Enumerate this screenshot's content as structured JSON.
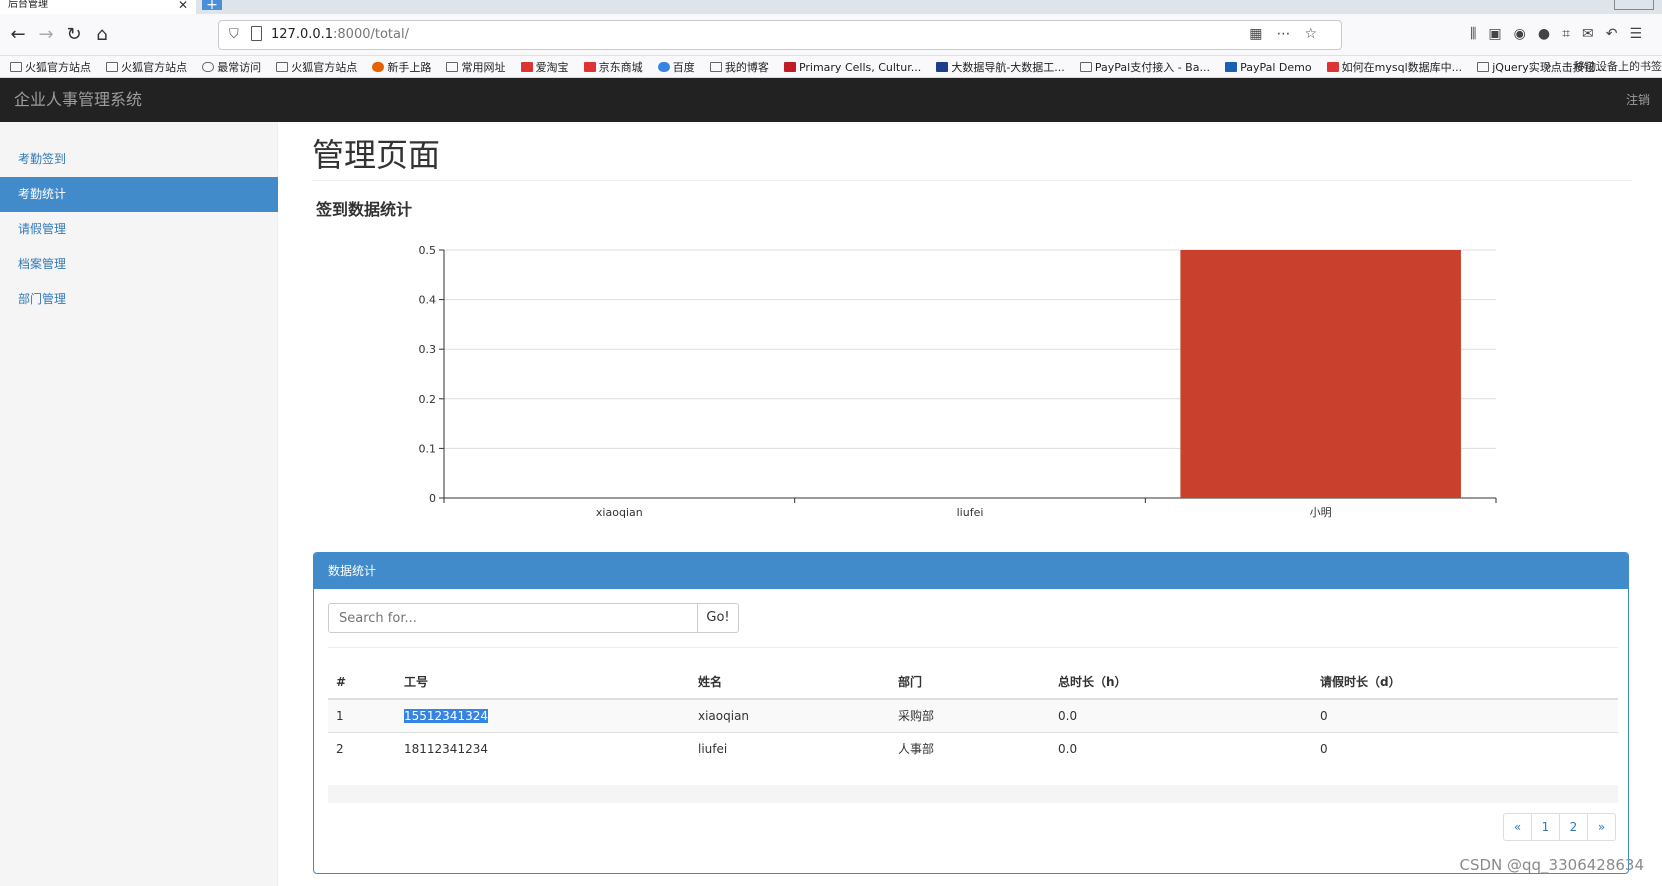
{
  "browser": {
    "tab_title": "后台管理",
    "tab_close": "✕",
    "new_tab": "+",
    "url_host": "127.0.0.1",
    "url_rest": ":8000/total/",
    "bookmarks": [
      "火狐官方站点",
      "火狐官方站点",
      "最常访问",
      "火狐官方站点",
      "新手上路",
      "常用网址",
      "爱淘宝",
      "京东商城",
      "百度",
      "我的博客",
      "Primary Cells, Cultur...",
      "大数据导航-大数据工...",
      "PayPal支付接入 - Ba...",
      "PayPal Demo",
      "如何在mysql数据库中...",
      "jQuery实现点击按钮..."
    ],
    "bookmarks_more": "»",
    "mobile_bookmarks": "移动设备上的书签"
  },
  "app": {
    "brand": "企业人事管理系统",
    "logout": "注销"
  },
  "sidebar": {
    "items": [
      {
        "label": "考勤签到",
        "active": false
      },
      {
        "label": "考勤统计",
        "active": true
      },
      {
        "label": "请假管理",
        "active": false
      },
      {
        "label": "档案管理",
        "active": false
      },
      {
        "label": "部门管理",
        "active": false
      }
    ]
  },
  "main": {
    "title": "管理页面",
    "section_title": "签到数据统计"
  },
  "chart_data": {
    "type": "bar",
    "categories": [
      "xiaoqian",
      "liufei",
      "小明"
    ],
    "values": [
      0,
      0,
      0.5
    ],
    "ylim": [
      0,
      0.5
    ],
    "yticks": [
      0,
      0.1,
      0.2,
      0.3,
      0.4,
      0.5
    ],
    "grid": true,
    "bar_color": "#c9402c"
  },
  "panel": {
    "heading": "数据统计",
    "search_placeholder": "Search for...",
    "go_label": "Go!",
    "columns": [
      "#",
      "工号",
      "姓名",
      "部门",
      "总时长（h）",
      "请假时长（d）"
    ],
    "rows": [
      {
        "num": "1",
        "id": "15512341324",
        "name": "xiaoqian",
        "dept": "采购部",
        "total": "0.0",
        "leave": "0"
      },
      {
        "num": "2",
        "id": "18112341234",
        "name": "liufei",
        "dept": "人事部",
        "total": "0.0",
        "leave": "0"
      }
    ],
    "pagination": [
      "«",
      "1",
      "2",
      "»"
    ]
  },
  "watermark": "CSDN @qq_3306428634",
  "colors": {
    "accent": "#428bca",
    "header": "#222222",
    "bar": "#c9402c"
  }
}
